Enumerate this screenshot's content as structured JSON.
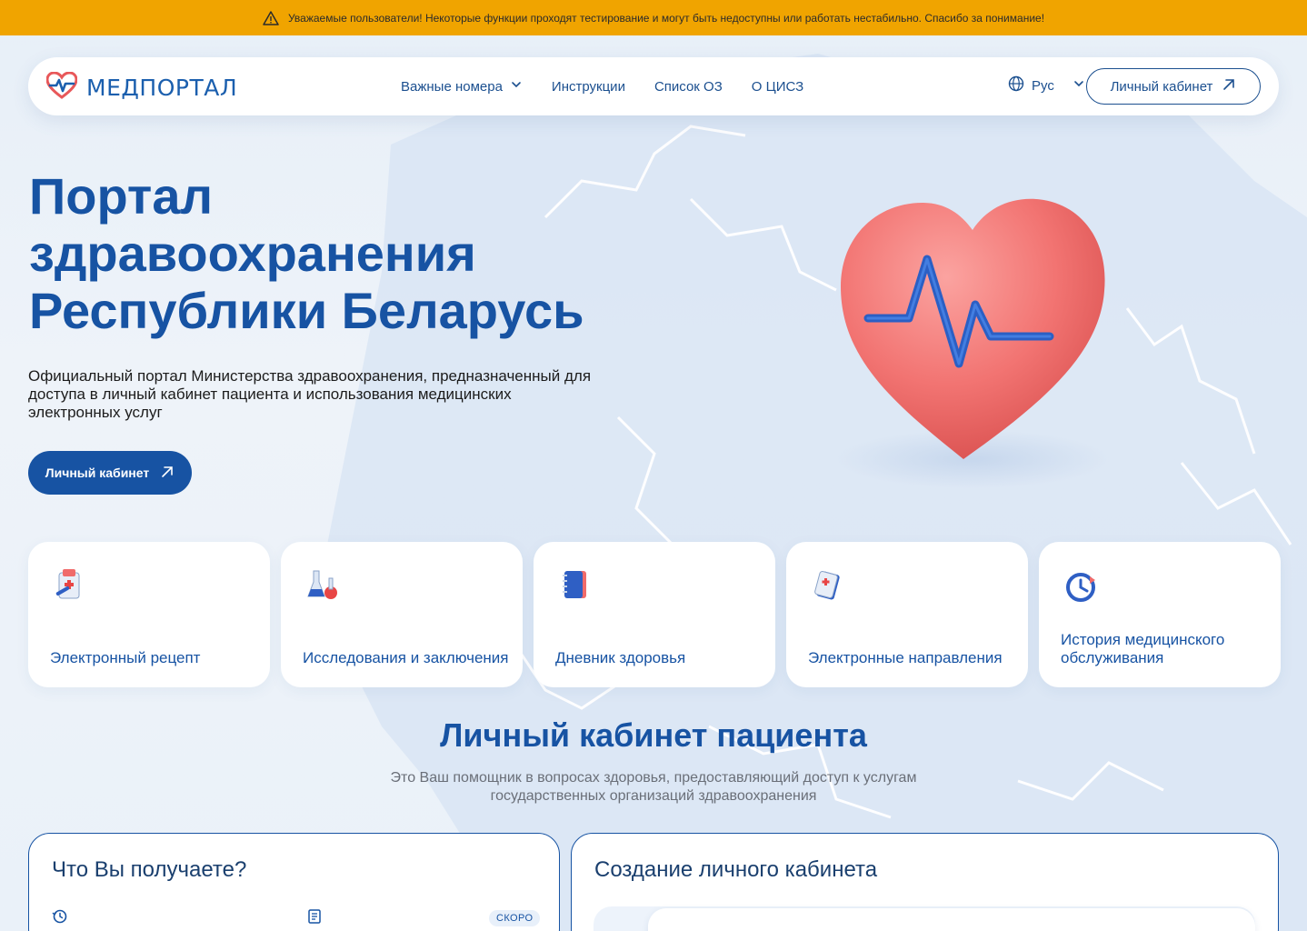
{
  "banner": {
    "text": "Уважаемые пользователи! Некоторые функции проходят тестирование и могут быть недоступны или работать нестабильно. Спасибо за понимание!"
  },
  "header": {
    "logo_text": "МЕДПОРТАЛ",
    "nav": [
      {
        "label": "Важные номера",
        "has_dropdown": true
      },
      {
        "label": "Инструкции"
      },
      {
        "label": "Список ОЗ"
      },
      {
        "label": "О ЦИСЗ"
      }
    ],
    "language": "Рус",
    "cabinet_button": "Личный кабинет"
  },
  "hero": {
    "title_line1": "Портал",
    "title_line2": "здравоохранения",
    "title_line3": "Республики Беларусь",
    "description": "Официальный портал Министерства здравоохранения, предназначенный для доступа в личный кабинет пациента и использования медицинских электронных услуг",
    "button": "Личный кабинет"
  },
  "services": [
    {
      "label": "Электронный рецепт",
      "icon": "prescription-icon"
    },
    {
      "label": "Исследования и заключения",
      "icon": "flasks-icon"
    },
    {
      "label": "Дневник здоровья",
      "icon": "notebook-icon"
    },
    {
      "label": "Электронные направления",
      "icon": "referral-icon"
    },
    {
      "label": "История медицинского обслуживания",
      "icon": "clock-history-icon"
    }
  ],
  "patient_section": {
    "title": "Личный кабинет пациента",
    "subtitle": "Это Ваш помощник в вопросах здоровья, предоставляющий доступ к услугам государственных организаций здравоохранения"
  },
  "panels": {
    "left_title": "Что Вы получаете?",
    "badge": "СКОРО",
    "right_title": "Создание личного кабинета"
  },
  "colors": {
    "primary": "#1753a3",
    "banner": "#f0a400",
    "heart": "#f0706f"
  }
}
